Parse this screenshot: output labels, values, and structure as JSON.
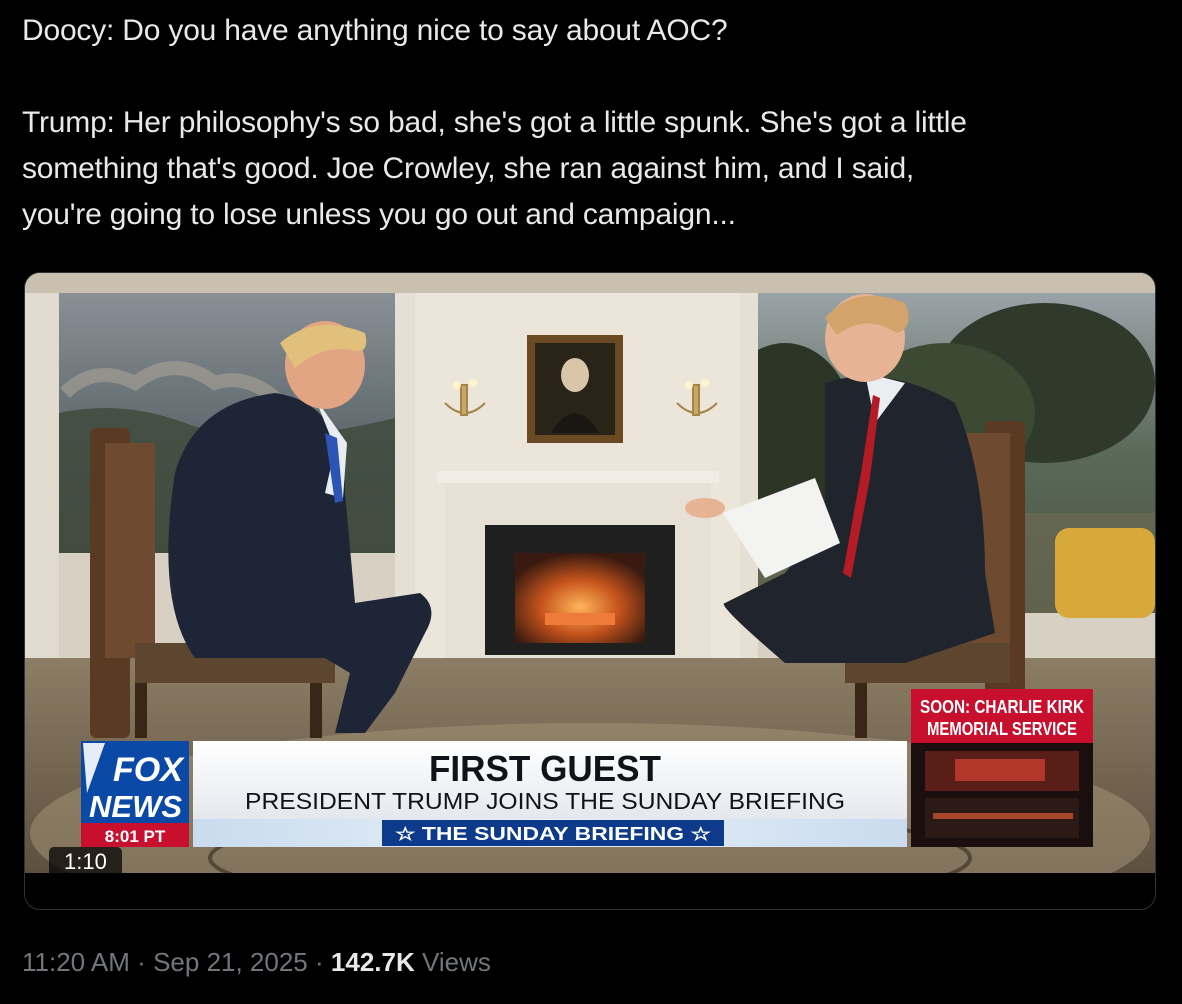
{
  "tweet": {
    "line1": "Doocy: Do you have anything nice to say about AOC?",
    "line2": "Trump: Her philosophy's so bad, she's got a little spunk. She's got a little",
    "line3": "something that's good. Joe Crowley, she ran against him, and I said,",
    "line4": "you're going to lose unless you go out and campaign..."
  },
  "video": {
    "duration_badge": "1:10",
    "chyron": {
      "headline": "FIRST GUEST",
      "subhead": "PRESIDENT TRUMP JOINS THE SUNDAY BRIEFING",
      "show_name": "☆ THE SUNDAY BRIEFING ☆"
    },
    "network": {
      "logo_top": "FOX",
      "logo_bottom": "NEWS",
      "clock": "8:01 PT"
    },
    "promo": {
      "line1": "SOON: CHARLIE KIRK",
      "line2": "MEMORIAL SERVICE"
    }
  },
  "meta": {
    "time": "11:20 AM",
    "separator": "·",
    "date": "Sep 21, 2025",
    "views_count": "142.7K",
    "views_label": "Views"
  },
  "colors": {
    "background": "#000000",
    "text_primary": "#e7e9ea",
    "text_secondary": "#71767b",
    "card_border": "#2f3336",
    "fox_blue": "#0a4aa6",
    "fox_red": "#c8102e"
  }
}
